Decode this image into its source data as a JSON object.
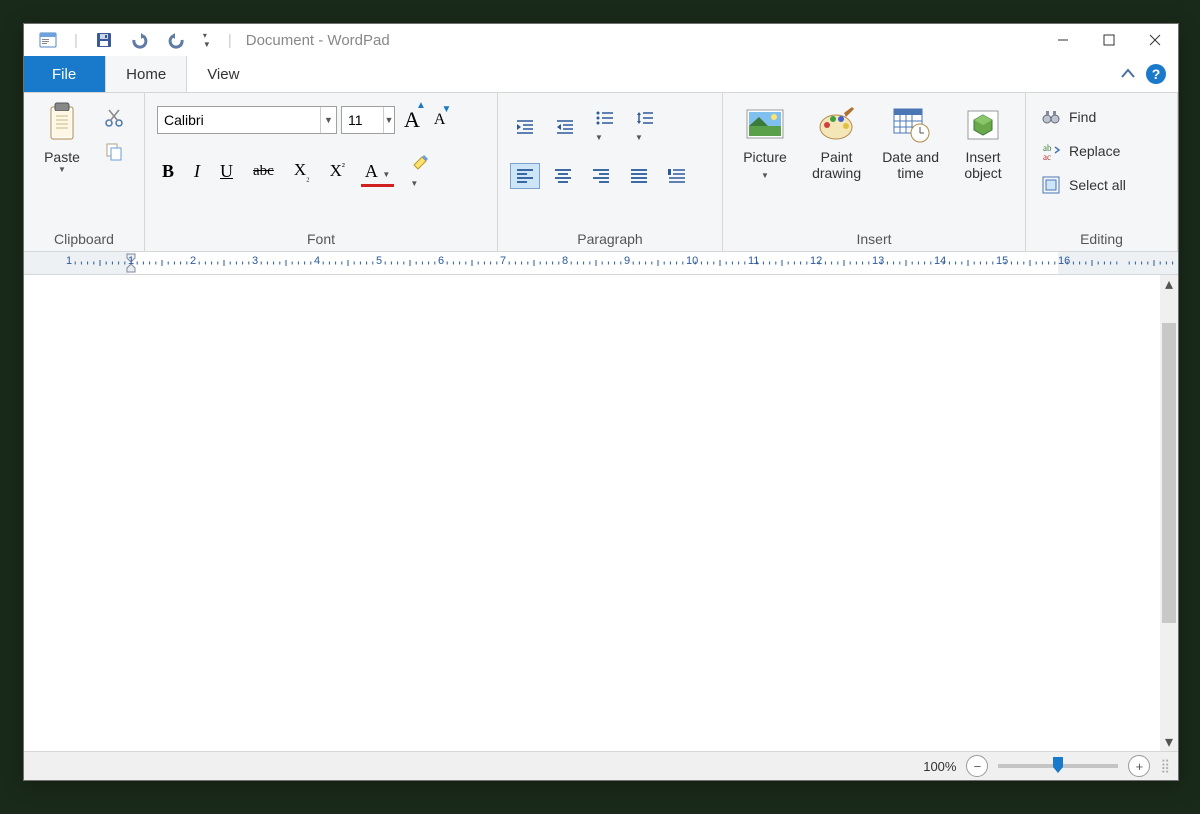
{
  "title": "Document - WordPad",
  "tabs": {
    "file": "File",
    "home": "Home",
    "view": "View"
  },
  "clipboard": {
    "paste": "Paste",
    "label": "Clipboard"
  },
  "font": {
    "name": "Calibri",
    "size": "11",
    "label": "Font"
  },
  "paragraph": {
    "label": "Paragraph"
  },
  "insert": {
    "picture": "Picture",
    "paint": "Paint drawing",
    "date": "Date and time",
    "object": "Insert object",
    "label": "Insert"
  },
  "editing": {
    "find": "Find",
    "replace": "Replace",
    "selectall": "Select all",
    "label": "Editing"
  },
  "ruler": [
    "1",
    "1",
    "2",
    "3",
    "4",
    "5",
    "6",
    "7",
    "8",
    "9",
    "10",
    "11",
    "12",
    "13",
    "14",
    "15",
    "16"
  ],
  "zoom": "100%"
}
